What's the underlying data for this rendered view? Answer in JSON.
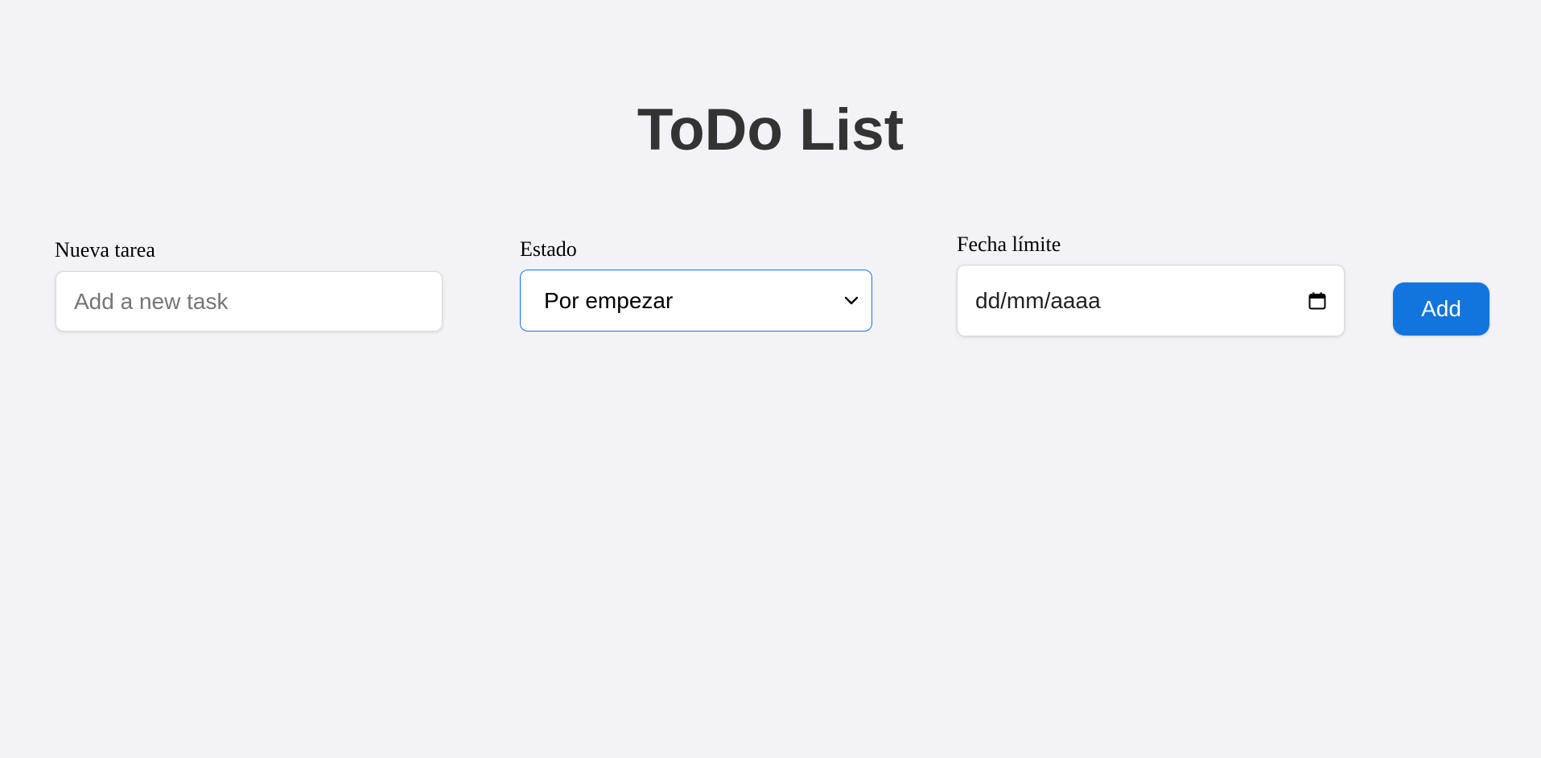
{
  "page": {
    "title": "ToDo List"
  },
  "form": {
    "task": {
      "label": "Nueva tarea",
      "placeholder": "Add a new task",
      "value": ""
    },
    "status": {
      "label": "Estado",
      "selected": "Por empezar",
      "icon": "chevron-down-icon"
    },
    "due_date": {
      "label": "Fecha límite",
      "placeholder": "dd/mm/aaaa",
      "icon": "calendar-icon"
    },
    "add_label": "Add"
  },
  "colors": {
    "background": "#f3f3f7",
    "title": "#333333",
    "accent": "#1275dd",
    "focus_border": "#1a73e8"
  }
}
